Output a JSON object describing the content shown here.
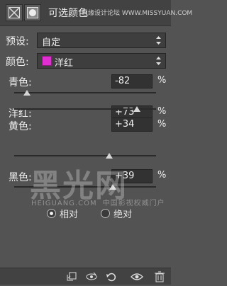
{
  "header": {
    "title": "可选颜色",
    "watermark": "思缘设计论坛 WWW.MISSYUAN.COM"
  },
  "preset": {
    "label": "预设:",
    "value": "自定"
  },
  "colors": {
    "label": "颜色:",
    "value": "洋红",
    "swatch_color": "#e02fd0"
  },
  "sliders": [
    {
      "label": "青色:",
      "value": "-82",
      "unit": "%",
      "level": -82
    },
    {
      "label": "洋红:",
      "value": "+73",
      "unit": "%",
      "level": 73
    },
    {
      "label": "黄色:",
      "value": "+34",
      "unit": "%",
      "level": 34
    },
    {
      "label": "黑色:",
      "value": "+39",
      "unit": "%",
      "level": 39
    }
  ],
  "method": {
    "relative_label": "相对",
    "absolute_label": "绝对",
    "selected": "relative"
  },
  "watermark": {
    "logo": "黑光网",
    "site": "HEIGUANG.COM",
    "slogan": "中国影视权威门户"
  },
  "footer": {
    "icons": [
      "clip-to-layer-icon",
      "visibility-cycle-icon",
      "reset-icon",
      "eye-icon",
      "trash-icon"
    ]
  }
}
